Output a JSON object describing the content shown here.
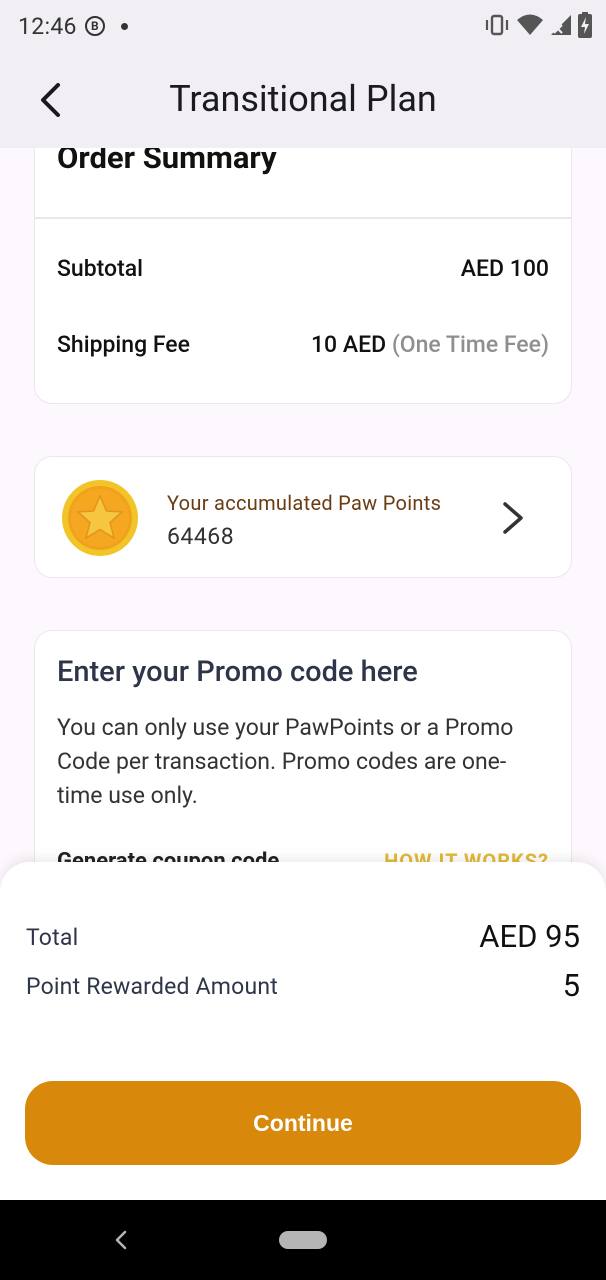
{
  "status_bar": {
    "time": "12:46",
    "badge": "B",
    "icons": [
      "vibrate-icon",
      "wifi-icon",
      "signal-icon",
      "battery-charging-icon"
    ]
  },
  "app_bar": {
    "title": "Transitional Plan",
    "back_icon": "chevron-left-icon"
  },
  "order_summary": {
    "title": "Order Summary",
    "subtotal_label": "Subtotal",
    "subtotal_value": "AED 100",
    "shipping_label": "Shipping Fee",
    "shipping_value": "10 AED",
    "shipping_note": "(One Time Fee)"
  },
  "paw_points": {
    "label": "Your accumulated Paw Points",
    "value": "64468",
    "icon": "star-coin-icon"
  },
  "promo": {
    "title": "Enter your Promo code here",
    "description": "You can only use your PawPoints or a Promo Code per transaction. Promo codes are one-time use only.",
    "generate_label": "Generate coupon code",
    "how_it_works": "HOW IT WORKS?"
  },
  "summary": {
    "total_label": "Total",
    "total_value": "AED 95",
    "reward_label": "Point Rewarded Amount",
    "reward_value": "5",
    "continue_label": "Continue"
  },
  "colors": {
    "accent": "#d8890c",
    "points_label": "#6a3c13",
    "how_it_works": "#e4b938",
    "app_bar_bg": "#f1eff3"
  }
}
